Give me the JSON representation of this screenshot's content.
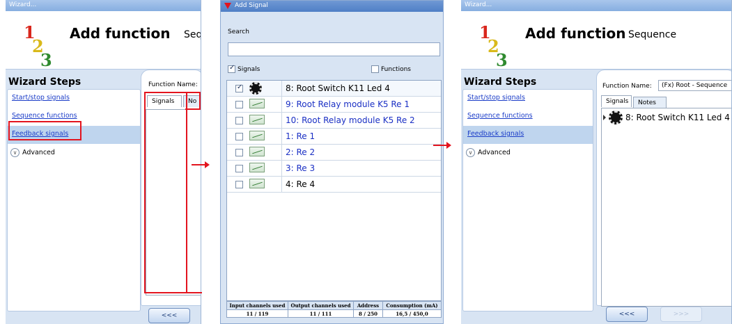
{
  "panel1": {
    "window_title": "Wizard...",
    "logo": {
      "n1": "1",
      "n2": "2",
      "n3": "3"
    },
    "header_title": "Add function",
    "header_sub": "Seq",
    "steps_title": "Wizard Steps",
    "steps": [
      "Start/stop signals",
      "Sequence functions",
      "Feedback signals"
    ],
    "advanced_label": "Advanced",
    "fn_name_label": "Function Name:",
    "tab_signals": "Signals",
    "tab_notes": "No",
    "prev_button": "<<<"
  },
  "panel2": {
    "window_title": "Add Signal",
    "search_label": "Search",
    "search_value": "",
    "filter_signals": "Signals",
    "filter_functions": "Functions",
    "signals": [
      {
        "label": "8: Root Switch K11 Led 4",
        "checked": true,
        "icon": "switch-icon",
        "color": "#000000"
      },
      {
        "label": "9: Root Relay module K5 Re 1",
        "checked": false,
        "icon": "relay-icon",
        "color": "#1a2fc4"
      },
      {
        "label": "10: Root Relay module K5 Re 2",
        "checked": false,
        "icon": "relay-icon",
        "color": "#1a2fc4"
      },
      {
        "label": "1: Re 1",
        "checked": false,
        "icon": "relay-icon",
        "color": "#1a2fc4"
      },
      {
        "label": "2: Re 2",
        "checked": false,
        "icon": "relay-icon",
        "color": "#1a2fc4"
      },
      {
        "label": "3: Re 3",
        "checked": false,
        "icon": "relay-icon",
        "color": "#1a2fc4"
      },
      {
        "label": "4: Re 4",
        "checked": false,
        "icon": "relay-icon",
        "color": "#000000"
      }
    ],
    "stats": [
      {
        "header": "Input channels used",
        "value": "11 / 119"
      },
      {
        "header": "Output channels used",
        "value": "11 / 111"
      },
      {
        "header": "Address",
        "value": "8 / 250"
      },
      {
        "header": "Consumption (mA)",
        "value": "16,5 / 450,0"
      }
    ]
  },
  "panel3": {
    "window_title": "Wizard...",
    "logo": {
      "n1": "1",
      "n2": "2",
      "n3": "3"
    },
    "header_title": "Add function",
    "header_sub": "Sequence",
    "steps_title": "Wizard Steps",
    "steps": [
      "Start/stop signals",
      "Sequence functions",
      "Feedback signals"
    ],
    "advanced_label": "Advanced",
    "fn_name_label": "Function Name:",
    "fn_name_value": "(Fx) Root - Sequence",
    "tab_signals": "Signals",
    "tab_notes": "Notes",
    "selected_signal": "8: Root Switch K11 Led 4",
    "prev_button": "<<<",
    "next_button": ">>>"
  },
  "colors": {
    "highlight": "#e3141e",
    "link": "#1a3cc8",
    "selection": "#bfd5ee"
  }
}
